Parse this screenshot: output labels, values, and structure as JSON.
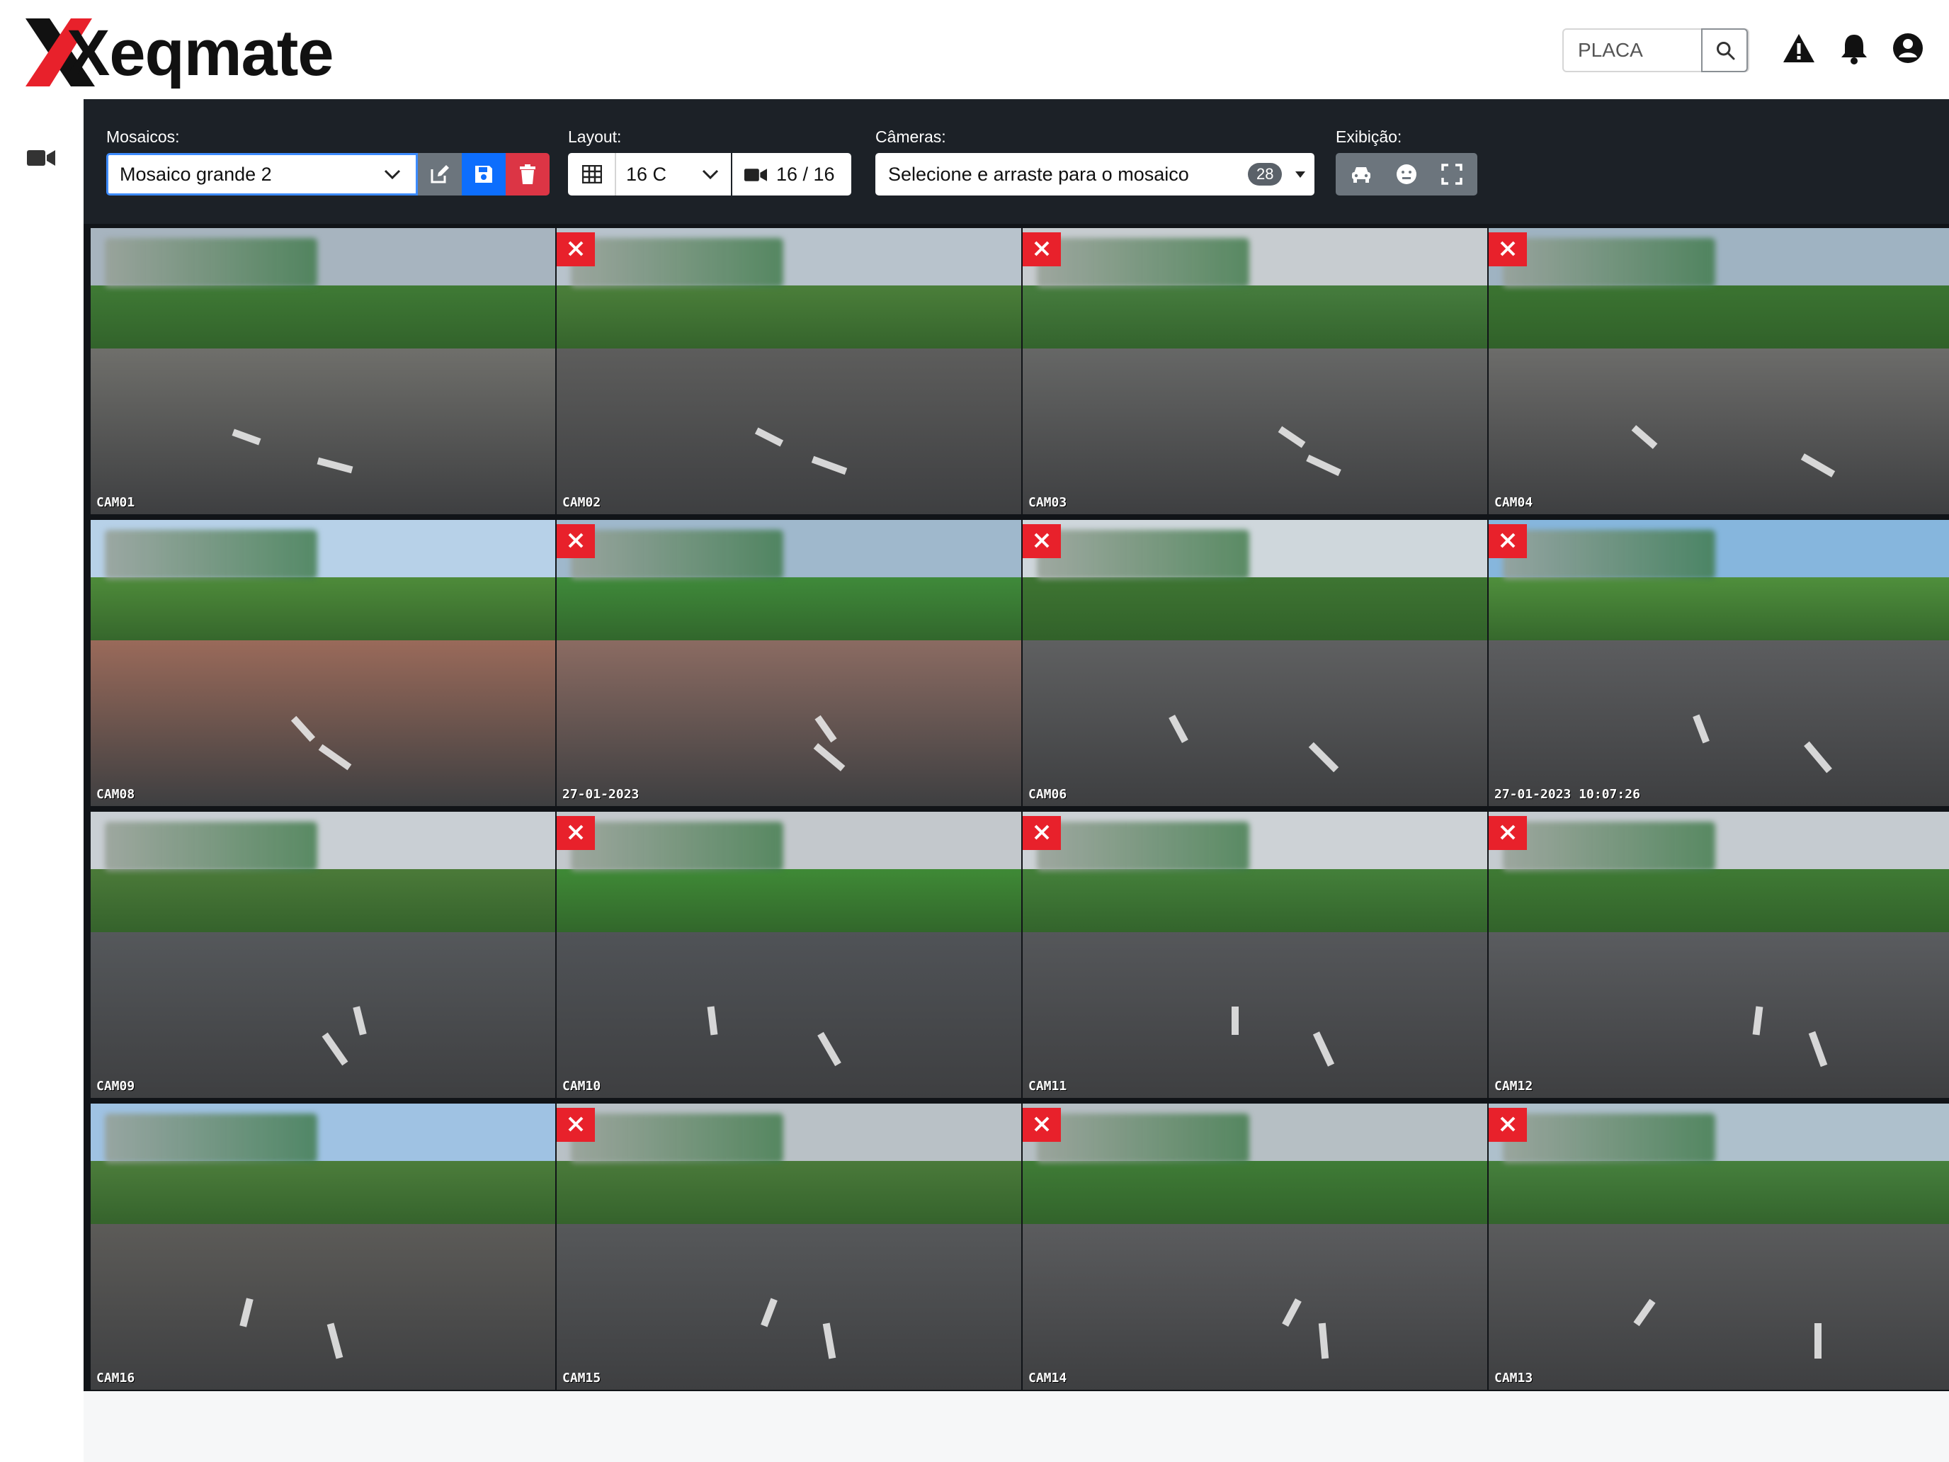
{
  "app": {
    "logo_text": "Xeqmate",
    "brand_red": "#e8212b"
  },
  "header": {
    "plate_search": {
      "placeholder": "PLACA"
    },
    "icons": [
      "alert-triangle-icon",
      "bell-icon",
      "user-circle-icon"
    ]
  },
  "sidebar": {
    "items": [
      {
        "icon": "video-camera-icon"
      }
    ]
  },
  "toolbar": {
    "mosaics_label": "Mosaicos:",
    "mosaic_selected": "Mosaico grande 2",
    "layout_label": "Layout:",
    "layout_selected": "16 C",
    "camera_count": "16 / 16",
    "cameras_label": "Câmeras:",
    "cameras_placeholder": "Selecione e arraste para o mosaico",
    "cameras_badge": "28",
    "display_label": "Exibição:"
  },
  "mosaic": {
    "tiles": [
      {
        "caption": "CAM01",
        "removable": false
      },
      {
        "caption": "CAM02",
        "removable": true
      },
      {
        "caption": "CAM03",
        "removable": true
      },
      {
        "caption": "CAM04",
        "removable": true
      },
      {
        "caption": "CAM08",
        "removable": false
      },
      {
        "caption": "",
        "timestamp": "27-01-2023",
        "removable": true
      },
      {
        "caption": "CAM06",
        "removable": true
      },
      {
        "caption": "",
        "timestamp": "27-01-2023 10:07:26",
        "removable": true
      },
      {
        "caption": "CAM09",
        "removable": false
      },
      {
        "caption": "CAM10",
        "removable": true
      },
      {
        "caption": "CAM11",
        "removable": true
      },
      {
        "caption": "CAM12",
        "removable": true
      },
      {
        "caption": "CAM16",
        "removable": false
      },
      {
        "caption": "CAM15",
        "removable": true
      },
      {
        "caption": "CAM14",
        "removable": true
      },
      {
        "caption": "CAM13",
        "removable": true
      }
    ]
  }
}
